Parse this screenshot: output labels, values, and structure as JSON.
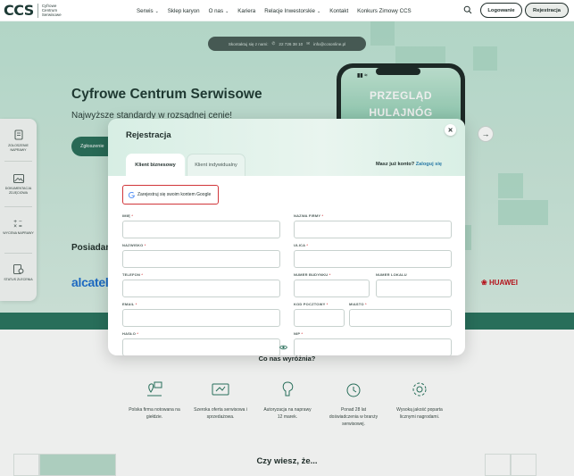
{
  "header": {
    "logo_mark": "CCS",
    "logo_text": "Cyfrowe Centrum Serwisowe",
    "nav": [
      {
        "label": "Serwis",
        "chevron": true
      },
      {
        "label": "Sklep karyon",
        "chevron": false
      },
      {
        "label": "O nas",
        "chevron": true
      },
      {
        "label": "Kariera",
        "chevron": false
      },
      {
        "label": "Relacje Inwestorskie",
        "chevron": true
      },
      {
        "label": "Kontakt",
        "chevron": false
      },
      {
        "label": "Konkurs Zimowy CCS",
        "chevron": false
      }
    ],
    "login_label": "Logowanie",
    "register_label": "Rejestracja"
  },
  "hero": {
    "contact_text": "Skontaktuj się z nami:",
    "phone": "22 726 38 10",
    "email": "info@ccsonline.pl",
    "title": "Cyfrowe Centrum Serwisowe",
    "subtitle": "Najwyższe standardy w rozsądnej cenie!",
    "button_label": "Zgłoszenie",
    "phone_promo_line1": "PRZEGLĄD",
    "phone_promo_line2": "HULAJNÓG",
    "brands_heading": "Posiadamy",
    "brand_left": "alcatel",
    "brand_right": "HUAWEI"
  },
  "side_toolbar": [
    {
      "label": "ZGŁOSZENIE NAPRAWY",
      "icon": "repair-request-icon"
    },
    {
      "label": "DOKUMENTACJA ZDJĘCIOWA",
      "icon": "photo-icon"
    },
    {
      "label": "WYCENA NAPRAWY",
      "icon": "calculator-icon"
    },
    {
      "label": "STATUS ZLECENIA",
      "icon": "status-icon"
    }
  ],
  "modal": {
    "title": "Rejestracja",
    "tabs": [
      {
        "label": "Klient biznesowy",
        "active": true
      },
      {
        "label": "Klient indywidualny",
        "active": false
      }
    ],
    "have_account": "Masz już konto?",
    "login_link": "Zaloguj się",
    "google_label": "Zarejestruj się swoim kontem Google",
    "fields": {
      "imie": "IMIĘ",
      "nazwa_firmy": "NAZWA FIRMY",
      "nazwisko": "NAZWISKO",
      "ulica": "ULICA",
      "telefon": "TELEFON",
      "numer_budynku": "NUMER BUDYNKU",
      "numer_lokalu": "NUMER LOKALU",
      "email": "EMAIL",
      "kod_pocztowy": "KOD POCZTOWY",
      "miasto": "MIASTO",
      "haslo": "HASŁO",
      "nip": "NIP"
    }
  },
  "lower": {
    "title": "Co nas wyróżnia?",
    "features": [
      {
        "text": "Polska firma notowana na giełdzie.",
        "icon": "map-pin-icon"
      },
      {
        "text": "Szeroka oferta serwisowa i sprzedażowa.",
        "icon": "devices-icon"
      },
      {
        "text": "Autoryzacja na naprawy 12 marek.",
        "icon": "badge-icon"
      },
      {
        "text": "Ponad 28 lat doświadczenia w branży serwisowej.",
        "icon": "clock-icon"
      },
      {
        "text": "Wysoką jakość poparta licznymi nagrodami.",
        "icon": "gear-icon"
      }
    ],
    "bottom_title": "Czy wiesz, że..."
  },
  "colors": {
    "brand_green": "#2a7560",
    "accent_link": "#2a7aa6",
    "required": "#d1363a"
  }
}
